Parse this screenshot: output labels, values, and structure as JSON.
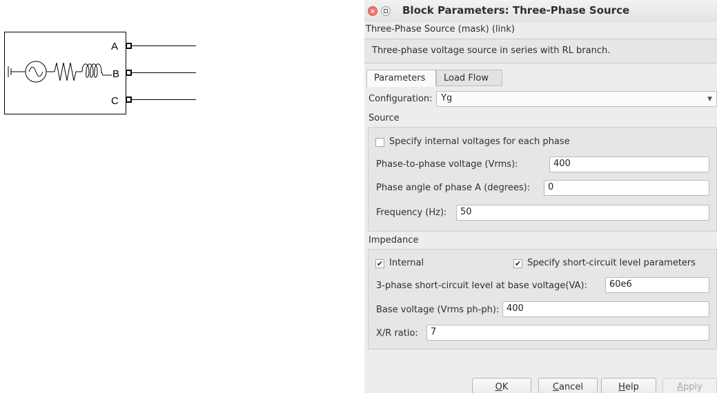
{
  "block": {
    "ports": [
      "A",
      "B",
      "C"
    ]
  },
  "dialog": {
    "title": "Block Parameters: Three-Phase Source",
    "close_glyph": "×",
    "mask_line": "Three-Phase Source (mask) (link)",
    "description": "Three-phase voltage source in series with RL branch.",
    "tabs": [
      {
        "label": "Parameters",
        "active": true
      },
      {
        "label": "Load Flow",
        "active": false
      }
    ],
    "configuration": {
      "label": "Configuration:",
      "value": "Yg",
      "arrow": "▼"
    },
    "source": {
      "heading": "Source",
      "specify_internal": {
        "label": "Specify internal voltages for each phase",
        "checked": false
      },
      "phase_voltage": {
        "label": "Phase-to-phase voltage (Vrms):",
        "value": "400"
      },
      "phase_angle": {
        "label": "Phase angle of phase A (degrees):",
        "value": "0"
      },
      "frequency": {
        "label": "Frequency (Hz):",
        "value": "50"
      }
    },
    "impedance": {
      "heading": "Impedance",
      "internal": {
        "label": "Internal",
        "checked": true,
        "mark": "✔"
      },
      "specify_sc": {
        "label": "Specify short-circuit level parameters",
        "checked": true,
        "mark": "✔"
      },
      "sc_level": {
        "label": "3-phase short-circuit level at base voltage(VA):",
        "value": "60e6"
      },
      "base_voltage": {
        "label": "Base voltage (Vrms ph-ph):",
        "value": "400"
      },
      "xr_ratio": {
        "label": "X/R ratio:",
        "value": "7"
      }
    },
    "buttons": {
      "ok": {
        "mnemonic": "O",
        "rest": "K"
      },
      "cancel": {
        "mnemonic": "C",
        "rest": "ancel"
      },
      "help": {
        "mnemonic": "H",
        "rest": "elp"
      },
      "apply": {
        "mnemonic": "A",
        "rest": "pply",
        "enabled": false
      }
    }
  }
}
